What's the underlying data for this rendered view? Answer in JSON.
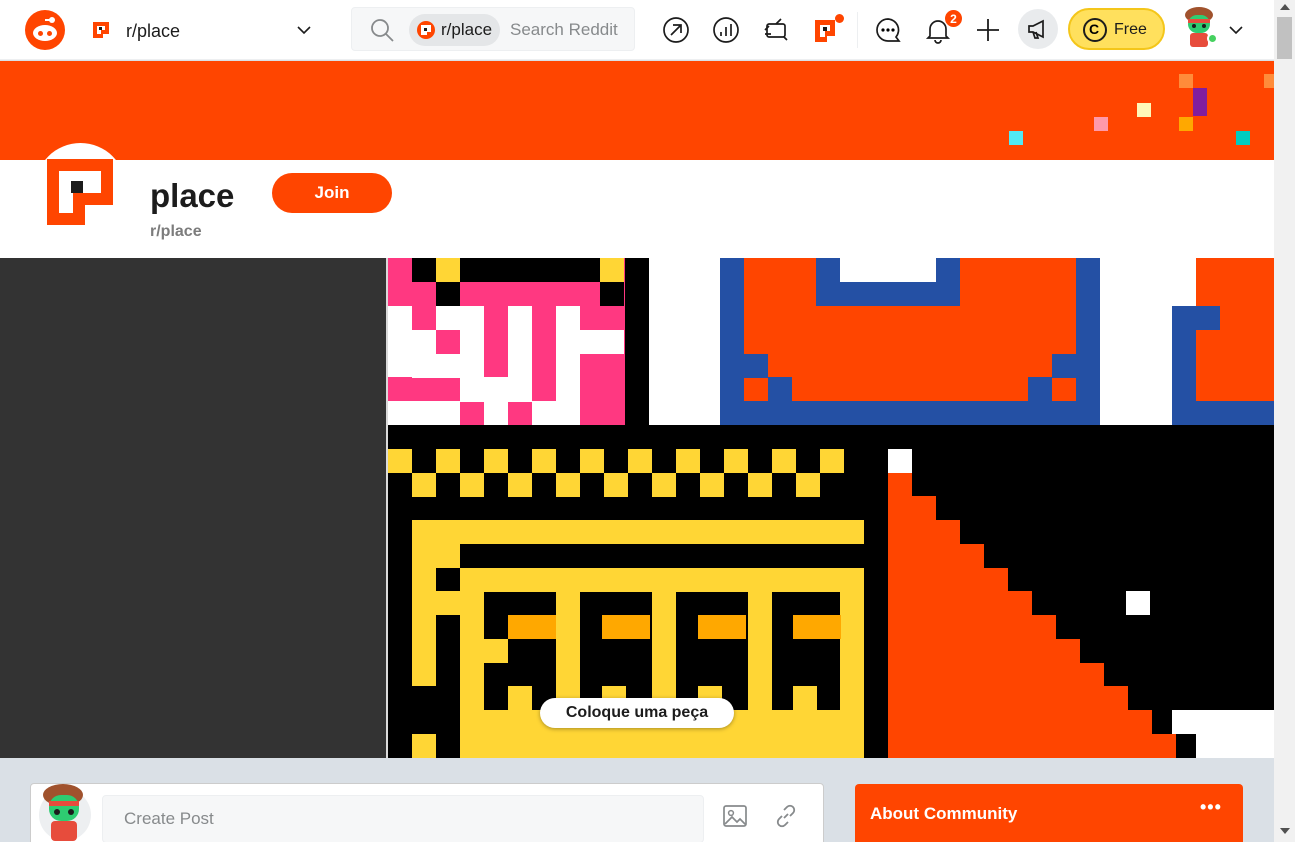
{
  "header": {
    "community_switcher": "r/place",
    "search": {
      "chip": "r/place",
      "placeholder": "Search Reddit"
    },
    "notification_count": "2",
    "coins_button": "Free",
    "icons": [
      "reddit-logo-icon",
      "popular-icon",
      "stats-icon",
      "watch-icon",
      "place-icon",
      "chat-icon",
      "bell-icon",
      "plus-icon",
      "megaphone-icon",
      "coin-icon",
      "chevron-down-icon"
    ]
  },
  "community": {
    "name": "place",
    "subreddit": "r/place",
    "join_label": "Join"
  },
  "canvas": {
    "place_tile_label": "Coloque uma peça"
  },
  "create_post": {
    "placeholder": "Create Post"
  },
  "sidebar": {
    "about_title": "About Community",
    "more": "•••"
  },
  "colors": {
    "accent": "#ff4500",
    "place_yellow": "#ffd635",
    "place_pink": "#ff3881",
    "place_blue": "#2450a4",
    "place_orange": "#ffa800"
  }
}
